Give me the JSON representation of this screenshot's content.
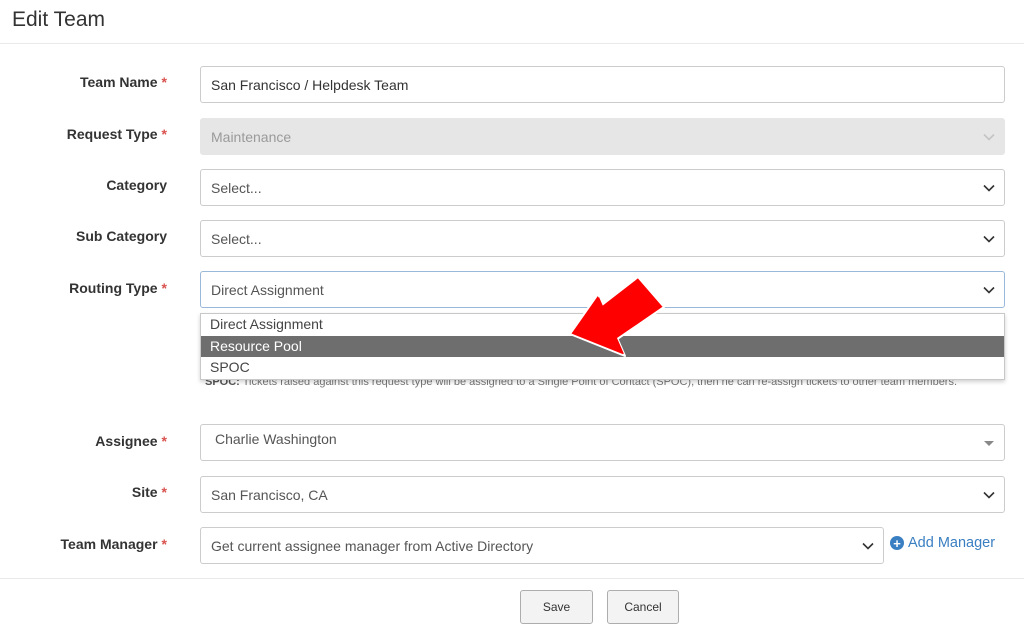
{
  "header": {
    "title": "Edit Team"
  },
  "form": {
    "required_mark": "*",
    "team_name": {
      "label": "Team Name",
      "value": "San Francisco / Helpdesk Team"
    },
    "request_type": {
      "label": "Request Type",
      "value": "Maintenance"
    },
    "category": {
      "label": "Category",
      "value": "Select..."
    },
    "sub_category": {
      "label": "Sub Category",
      "value": "Select..."
    },
    "routing_type": {
      "label": "Routing Type",
      "value": "Direct Assignment",
      "options": [
        "Direct Assignment",
        "Resource Pool",
        "SPOC"
      ],
      "highlighted": "Resource Pool"
    },
    "routing_help": {
      "bold": "SPOC:",
      "text": "Tickets raised against this request type will be assigned to a Single Point of Contact (SPOC), then he can re-assign tickets to other team members."
    },
    "assignee": {
      "label": "Assignee",
      "value": "Charlie Washington"
    },
    "site": {
      "label": "Site",
      "value": "San Francisco, CA"
    },
    "team_manager": {
      "label": "Team Manager",
      "value": "Get current assignee manager from Active Directory"
    },
    "add_manager": {
      "label": "Add Manager"
    }
  },
  "footer": {
    "save_label": "Save",
    "cancel_label": "Cancel"
  },
  "colors": {
    "required": "#d9534f",
    "link": "#3a7fc2",
    "highlight": "#6e6e6e",
    "arrow": "#ff0000"
  },
  "icons": {
    "chevron": "chevron-down-icon",
    "add": "plus-circle-icon",
    "annotation": "red-arrow-icon"
  }
}
